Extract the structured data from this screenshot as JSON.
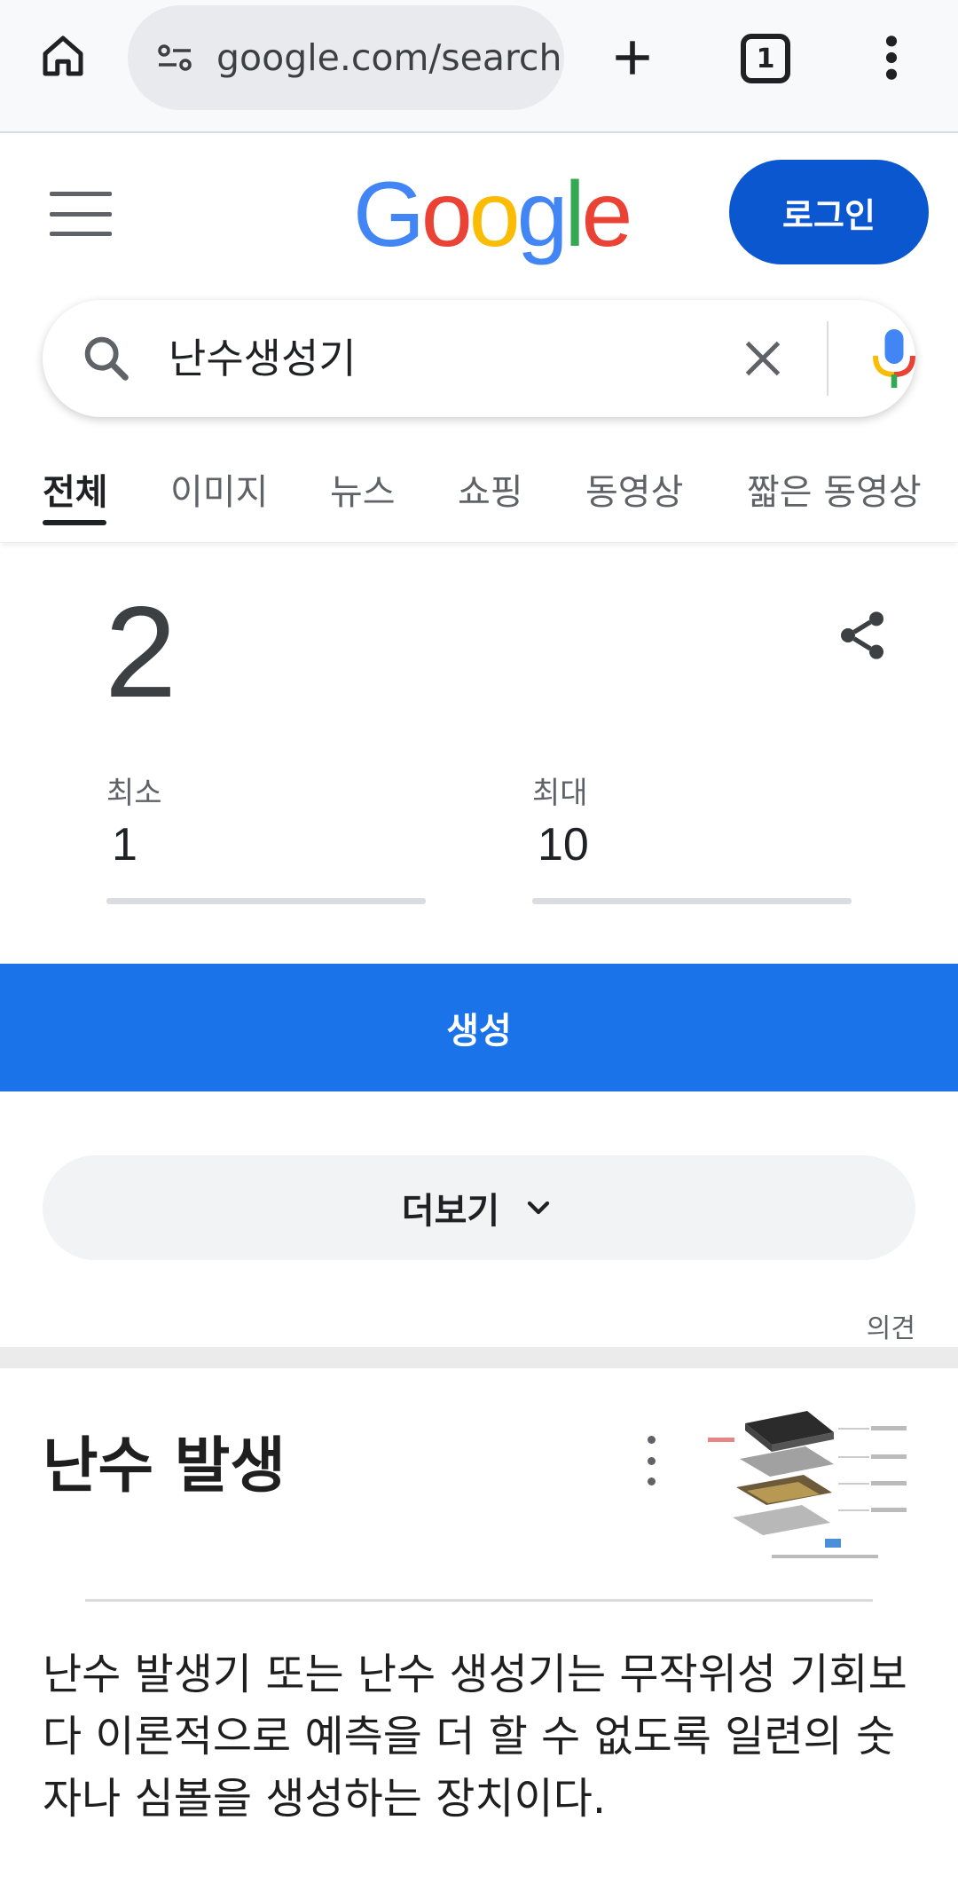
{
  "browser": {
    "url": "google.com/search",
    "tab_count": "1",
    "icons": [
      "home-icon",
      "site-info-icon",
      "new-tab-icon",
      "tab-switcher-icon",
      "more-vert-icon"
    ]
  },
  "header": {
    "logo_parts": [
      "G",
      "o",
      "o",
      "g",
      "l",
      "e"
    ],
    "login_label": "로그인"
  },
  "search": {
    "query": "난수생성기"
  },
  "tabs": [
    {
      "label": "전체",
      "active": true
    },
    {
      "label": "이미지",
      "active": false
    },
    {
      "label": "뉴스",
      "active": false
    },
    {
      "label": "쇼핑",
      "active": false
    },
    {
      "label": "동영상",
      "active": false
    },
    {
      "label": "짧은 동영상",
      "active": false
    }
  ],
  "rng": {
    "result": "2",
    "min_label": "최소",
    "min_value": "1",
    "max_label": "최대",
    "max_value": "10",
    "generate_label": "생성"
  },
  "more": {
    "label": "더보기"
  },
  "feedback_label": "의견",
  "knowledge": {
    "title": "난수 발생",
    "description": "난수 발생기 또는 난수 생성기는 무작위성 기회보다 이론적으로 예측을 더 할 수 없도록 일련의 숫자나 심볼을 생성하는 장치이다."
  },
  "colors": {
    "accent": "#1a73e8",
    "login_bg": "#0b57d0",
    "google_blue": "#4285f4",
    "google_red": "#ea4335",
    "google_yellow": "#fbbc05",
    "google_green": "#34a853"
  }
}
